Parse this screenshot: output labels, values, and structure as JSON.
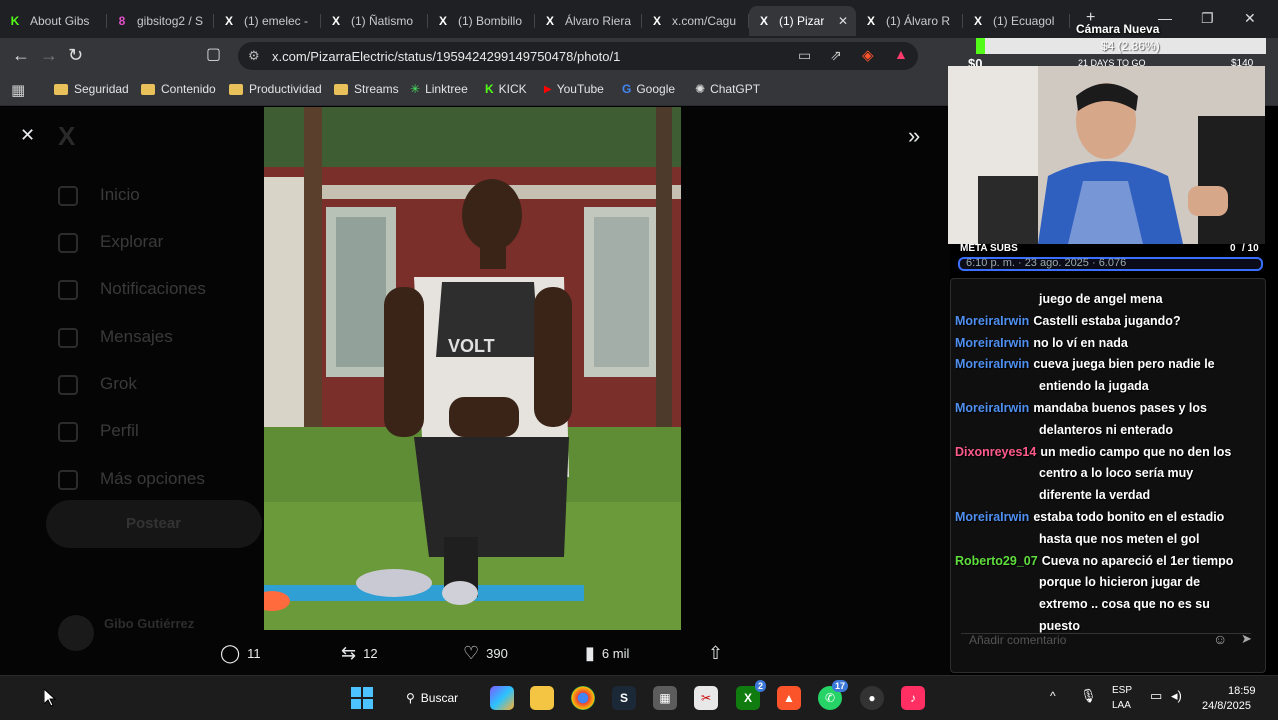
{
  "tabs": [
    {
      "label": "About Gibs",
      "icon": "K",
      "icon_color": "#53fc18"
    },
    {
      "label": "gibsitog2 / S",
      "icon": "8",
      "icon_color": "#e04ec8"
    },
    {
      "label": "(1) emelec -",
      "icon": "X",
      "icon_color": "#ffffff"
    },
    {
      "label": "(1) Ñatismo",
      "icon": "X",
      "icon_color": "#ffffff"
    },
    {
      "label": "(1) Bombillo",
      "icon": "X",
      "icon_color": "#ffffff"
    },
    {
      "label": "Álvaro Riera",
      "icon": "X",
      "icon_color": "#ffffff"
    },
    {
      "label": "x.com/Cagu",
      "icon": "X",
      "icon_color": "#ffffff"
    },
    {
      "label": "(1) Pizar",
      "icon": "X",
      "icon_color": "#ffffff"
    },
    {
      "label": "(1) Álvaro R",
      "icon": "X",
      "icon_color": "#ffffff"
    },
    {
      "label": "(1) Ecuagol",
      "icon": "X",
      "icon_color": "#ffffff"
    }
  ],
  "active_tab_index": 7,
  "url": "x.com/PizarraElectric/status/1959424299149750478/photo/1",
  "bookmarks": [
    {
      "label": "Seguridad",
      "type": "folder"
    },
    {
      "label": "Contenido",
      "type": "folder"
    },
    {
      "label": "Productividad",
      "type": "folder"
    },
    {
      "label": "Streams",
      "type": "folder"
    },
    {
      "label": "Linktree",
      "type": "site"
    },
    {
      "label": "KICK",
      "type": "site"
    },
    {
      "label": "YouTube",
      "type": "site"
    },
    {
      "label": "Google",
      "type": "site"
    },
    {
      "label": "ChatGPT",
      "type": "site"
    }
  ],
  "x_sidebar": [
    "Inicio",
    "Explorar",
    "Notificaciones",
    "Mensajes",
    "Grok",
    "Perfil",
    "Más opciones"
  ],
  "post_button": "Postear",
  "profile_name": "Gibo Gutiérrez",
  "actions": {
    "replies": "11",
    "reposts": "12",
    "likes": "390",
    "views": "6 mil"
  },
  "stream": {
    "camera_label": "Cámara Nueva",
    "donation_min": "$0",
    "donation_max": "$140",
    "donation_current": "$4 (2.86%)",
    "donation_days": "21 DAYS TO GO",
    "meta_label": "META SUBS",
    "meta_count": "0",
    "meta_total": "/ 10",
    "meta_date": "6:10 p. m. · 23 ago. 2025 · 6.076"
  },
  "chat": [
    {
      "user": "",
      "text": "juego de angel mena",
      "color": "#ffffff"
    },
    {
      "user": "MoreiraIrwin",
      "text": "Castelli estaba jugando?",
      "color": "#4f8ff0"
    },
    {
      "user": "MoreiraIrwin",
      "text": "no lo ví en nada",
      "color": "#4f8ff0"
    },
    {
      "user": "MoreiraIrwin",
      "text": "cueva juega bien pero nadie le",
      "color": "#4f8ff0"
    },
    {
      "user": "",
      "text": "entiendo la jugada",
      "color": "#ffffff"
    },
    {
      "user": "MoreiraIrwin",
      "text": "mandaba buenos pases y los",
      "color": "#4f8ff0"
    },
    {
      "user": "",
      "text": "delanteros ni enterado",
      "color": "#ffffff"
    },
    {
      "user": "Dixonreyes14",
      "text": "un medio campo que no den los",
      "color": "#ff5a8a"
    },
    {
      "user": "",
      "text": "centro a lo loco sería muy",
      "color": "#ffffff"
    },
    {
      "user": "",
      "text": "diferente la verdad",
      "color": "#ffffff"
    },
    {
      "user": "MoreiraIrwin",
      "text": "estaba todo bonito en el estadio",
      "color": "#4f8ff0"
    },
    {
      "user": "",
      "text": "hasta que nos meten el gol",
      "color": "#ffffff"
    },
    {
      "user": "Roberto29_07",
      "text": "Cueva no apareció el 1er tiempo",
      "color": "#5fdd3d"
    },
    {
      "user": "",
      "text": "porque lo hicieron jugar de",
      "color": "#ffffff"
    },
    {
      "user": "",
      "text": "extremo .. cosa que no es su",
      "color": "#ffffff"
    },
    {
      "user": "",
      "text": "puesto",
      "color": "#ffffff"
    }
  ],
  "comment_placeholder": "Añadir comentario",
  "taskbar": {
    "search_label": "Buscar",
    "lang_top": "ESP",
    "lang_bottom": "LAA",
    "time": "18:59",
    "date": "24/8/2025",
    "xbox_badge": "2",
    "whatsapp_badge": "17"
  }
}
